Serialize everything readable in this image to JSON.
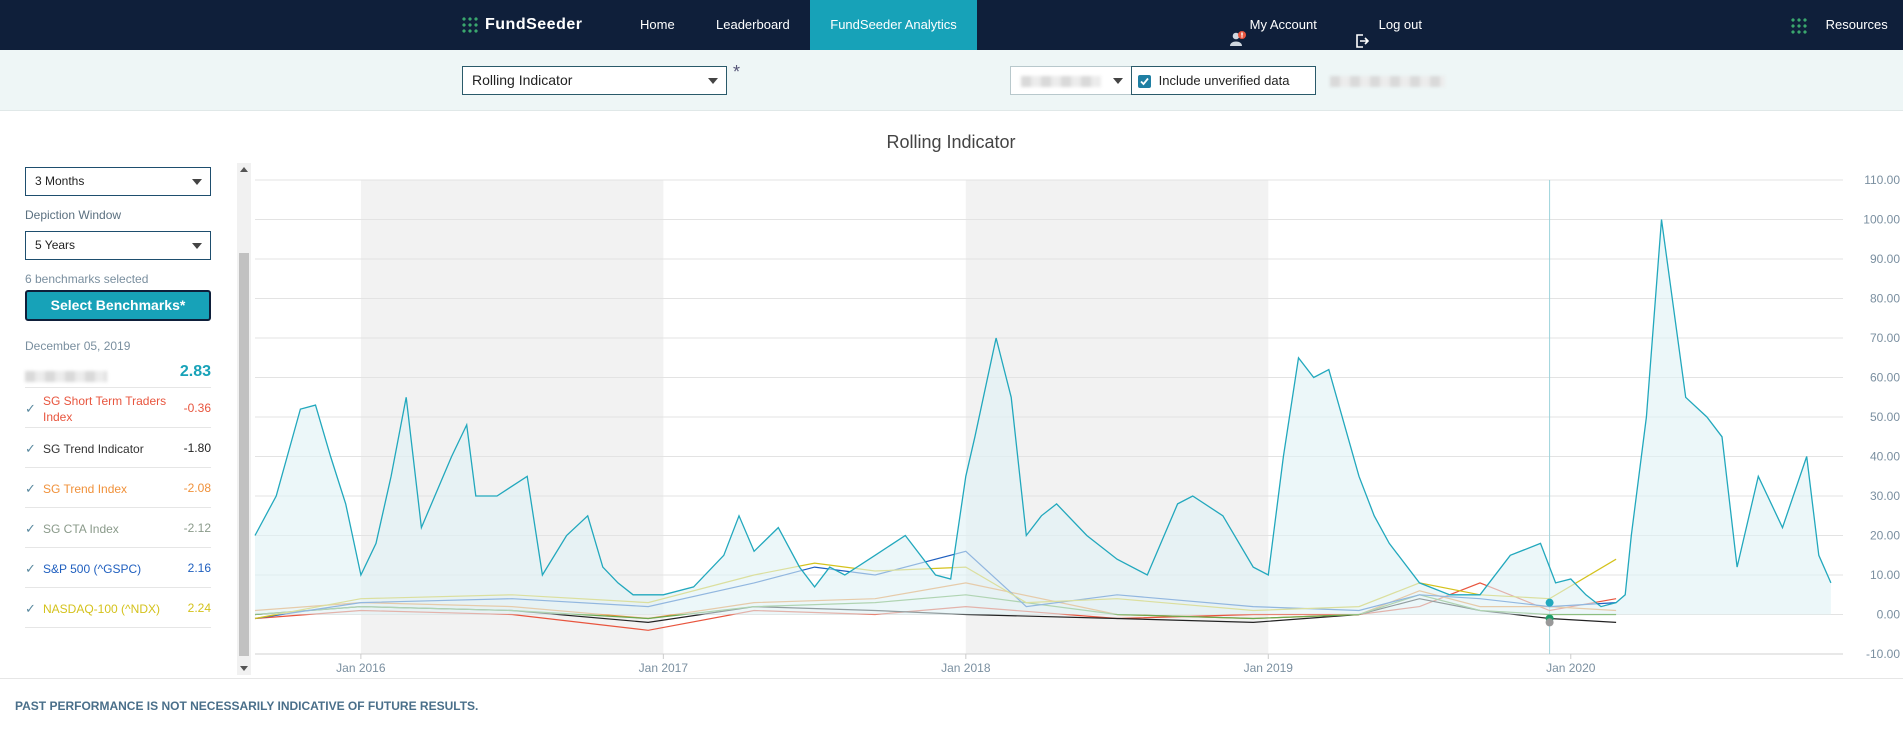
{
  "nav": {
    "logo_text": "FundSeeder",
    "home": "Home",
    "leaderboard": "Leaderboard",
    "analytics": "FundSeeder Analytics",
    "account": "My Account",
    "logout": "Log out",
    "resources": "Resources"
  },
  "controls": {
    "indicator_select": "Rolling Indicator",
    "asterisk": "*",
    "include_unverified": "Include unverified data"
  },
  "sidebar": {
    "period_select": "3 Months",
    "depiction_label": "Depiction Window",
    "depiction_select": "5 Years",
    "benchmarks_count": "6 benchmarks selected",
    "select_button": "Select Benchmarks*",
    "date": "December 05, 2019",
    "main_value": "2.83",
    "benchmarks": [
      {
        "name": "SG Short Term Traders Index",
        "value": "-0.36",
        "color": "#e8553e"
      },
      {
        "name": "SG Trend Indicator",
        "value": "-1.80",
        "color": "#222222"
      },
      {
        "name": "SG Trend Index",
        "value": "-2.08",
        "color": "#f0913a"
      },
      {
        "name": "SG CTA Index",
        "value": "-2.12",
        "color": "#8a9a8a"
      },
      {
        "name": "S&P 500 (^GSPC)",
        "value": "2.16",
        "color": "#1f5fbf"
      },
      {
        "name": "NASDAQ-100 (^NDX)",
        "value": "2.24",
        "color": "#d4c21c"
      }
    ]
  },
  "disclaimer": "PAST PERFORMANCE IS NOT NECESSARILY INDICATIVE OF FUTURE RESULTS.",
  "colors": {
    "accent": "#17a2b8",
    "nav_bg": "#0f1f3a",
    "main_series": "#22a8bd"
  },
  "chart_data": {
    "type": "line",
    "title": "Rolling Indicator",
    "x_tick_labels": [
      "Jan 2016",
      "Jan 2017",
      "Jan 2018",
      "Jan 2019",
      "Jan 2020"
    ],
    "y_tick_labels": [
      "110.00",
      "100.00",
      "90.00",
      "80.00",
      "70.00",
      "60.00",
      "50.00",
      "40.00",
      "30.00",
      "20.00",
      "10.00",
      "0.00",
      "-10.00"
    ],
    "ylim": [
      -10,
      110
    ],
    "x_range": [
      2015.65,
      2020.9
    ],
    "shaded_years": [
      [
        2016.0,
        2017.0
      ],
      [
        2018.0,
        2019.0
      ]
    ],
    "crosshair_x": 2019.93,
    "main_series": {
      "x": [
        2015.65,
        2015.72,
        2015.8,
        2015.85,
        2015.9,
        2015.95,
        2016.0,
        2016.05,
        2016.1,
        2016.15,
        2016.2,
        2016.3,
        2016.35,
        2016.38,
        2016.45,
        2016.55,
        2016.6,
        2016.68,
        2016.75,
        2016.8,
        2016.85,
        2016.9,
        2017.0,
        2017.1,
        2017.2,
        2017.25,
        2017.3,
        2017.38,
        2017.45,
        2017.5,
        2017.55,
        2017.6,
        2017.7,
        2017.8,
        2017.9,
        2017.95,
        2018.0,
        2018.03,
        2018.1,
        2018.15,
        2018.2,
        2018.25,
        2018.3,
        2018.4,
        2018.5,
        2018.6,
        2018.7,
        2018.75,
        2018.85,
        2018.95,
        2019.0,
        2019.05,
        2019.1,
        2019.15,
        2019.2,
        2019.3,
        2019.35,
        2019.4,
        2019.5,
        2019.6,
        2019.7,
        2019.8,
        2019.9,
        2019.95,
        2020.0,
        2020.05,
        2020.1,
        2020.15,
        2020.18,
        2020.2,
        2020.25,
        2020.3,
        2020.38,
        2020.45,
        2020.5,
        2020.55,
        2020.62,
        2020.7,
        2020.78,
        2020.82,
        2020.86
      ],
      "y": [
        20,
        30,
        52,
        53,
        40,
        28,
        10,
        18,
        35,
        55,
        22,
        40,
        48,
        30,
        30,
        35,
        10,
        20,
        25,
        12,
        8,
        5,
        5,
        7,
        15,
        25,
        16,
        22,
        12,
        7,
        12,
        10,
        15,
        20,
        10,
        9,
        35,
        45,
        70,
        55,
        20,
        25,
        28,
        20,
        14,
        10,
        28,
        30,
        25,
        12,
        10,
        40,
        65,
        60,
        62,
        35,
        25,
        18,
        8,
        5,
        5,
        15,
        18,
        8,
        9,
        5,
        2,
        3,
        5,
        20,
        50,
        100,
        55,
        50,
        45,
        12,
        35,
        22,
        40,
        15,
        8
      ],
      "color": "#22a8bd"
    },
    "series": [
      {
        "name": "SG Short Term Traders Index",
        "x": [
          2015.65,
          2016.0,
          2016.5,
          2016.95,
          2017.3,
          2017.7,
          2018.0,
          2018.5,
          2018.95,
          2019.3,
          2019.5,
          2019.7,
          2019.93,
          2020.15
        ],
        "y": [
          -1,
          1,
          0,
          -4,
          1,
          0,
          2,
          -1,
          0,
          0,
          2,
          8,
          1,
          4
        ],
        "color": "#e8553e"
      },
      {
        "name": "SG Trend Indicator",
        "x": [
          2015.65,
          2016.0,
          2016.5,
          2016.95,
          2017.3,
          2017.7,
          2018.0,
          2018.5,
          2018.95,
          2019.3,
          2019.5,
          2019.7,
          2019.93,
          2020.15
        ],
        "y": [
          0,
          2,
          1,
          -2,
          2,
          1,
          0,
          -1,
          -2,
          0,
          4,
          1,
          -1,
          -2
        ],
        "color": "#222222"
      },
      {
        "name": "SG Trend Index",
        "x": [
          2015.65,
          2016.0,
          2016.5,
          2016.95,
          2017.3,
          2017.7,
          2018.0,
          2018.5,
          2018.95,
          2019.3,
          2019.5,
          2019.7,
          2019.93,
          2020.15
        ],
        "y": [
          1,
          3,
          2,
          -1,
          3,
          4,
          8,
          0,
          -1,
          0,
          6,
          2,
          2,
          1
        ],
        "color": "#f0913a"
      },
      {
        "name": "SG CTA Index",
        "x": [
          2015.65,
          2016.0,
          2016.5,
          2016.95,
          2017.3,
          2017.7,
          2018.0,
          2018.5,
          2018.95,
          2019.3,
          2019.5,
          2019.7,
          2019.93,
          2020.15
        ],
        "y": [
          0,
          2,
          1,
          -1,
          2,
          3,
          5,
          0,
          -1,
          0,
          5,
          1,
          0,
          0
        ],
        "color": "#6aa84f"
      },
      {
        "name": "S&P 500 (^GSPC)",
        "x": [
          2015.65,
          2016.0,
          2016.5,
          2016.95,
          2017.3,
          2017.5,
          2017.7,
          2018.0,
          2018.2,
          2018.5,
          2018.95,
          2019.3,
          2019.5,
          2019.7,
          2019.93,
          2020.15
        ],
        "y": [
          -1,
          3,
          4,
          2,
          8,
          12,
          10,
          16,
          2,
          5,
          2,
          1,
          5,
          4,
          2,
          3
        ],
        "color": "#1f5fbf"
      },
      {
        "name": "NASDAQ-100 (^NDX)",
        "x": [
          2015.65,
          2016.0,
          2016.5,
          2016.95,
          2017.3,
          2017.5,
          2017.7,
          2018.0,
          2018.2,
          2018.5,
          2018.95,
          2019.3,
          2019.5,
          2019.7,
          2019.93,
          2020.15
        ],
        "y": [
          -1,
          4,
          5,
          3,
          10,
          13,
          11,
          12,
          3,
          4,
          1,
          2,
          8,
          5,
          4,
          14
        ],
        "color": "#d4c21c"
      }
    ]
  }
}
